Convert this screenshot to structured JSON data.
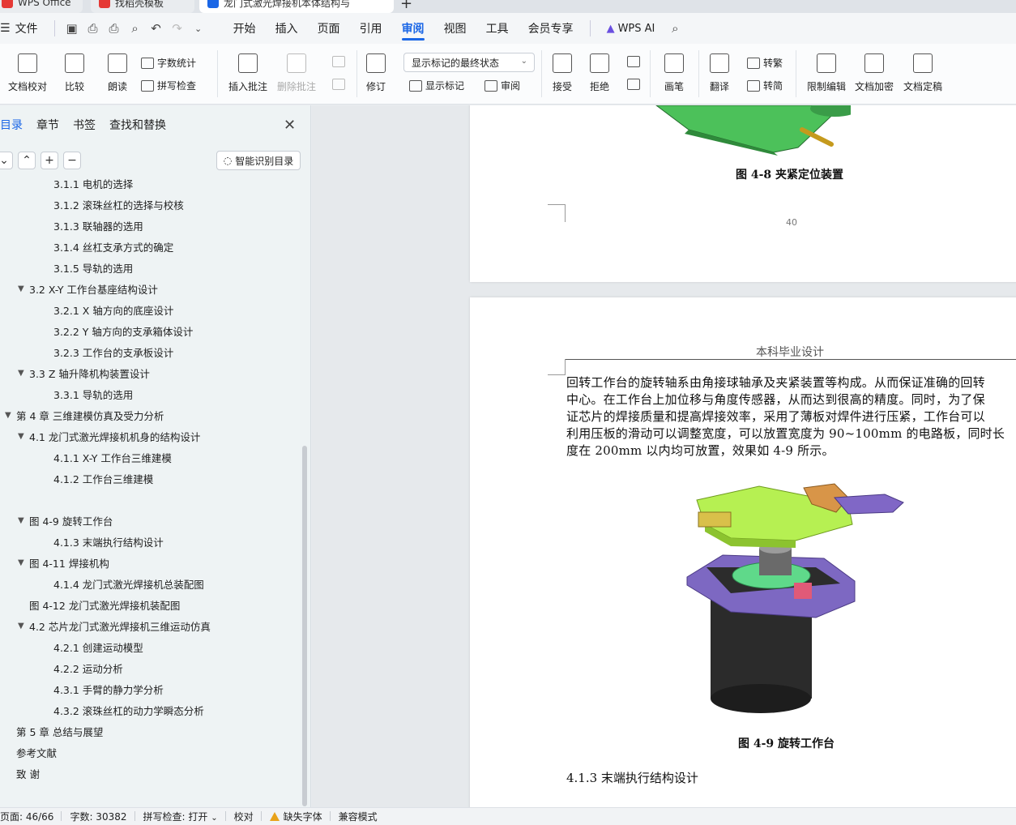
{
  "tabs": [
    {
      "label": "WPS Office",
      "color": "#e53935"
    },
    {
      "label": "找稻壳模板",
      "color": "#e53935"
    },
    {
      "label": "龙门式激光焊接机本体结构与",
      "color": "#1a66e6"
    }
  ],
  "menu": {
    "file": "文件",
    "items": [
      "开始",
      "插入",
      "页面",
      "引用",
      "审阅",
      "视图",
      "工具",
      "会员专享"
    ],
    "active": "审阅",
    "wps_ai": "WPS AI"
  },
  "ribbon": {
    "doc_proof": "文档校对",
    "compare": "比较",
    "read_aloud": "朗读",
    "word_count": "字数统计",
    "spell_check": "拼写检查",
    "insert_comment": "插入批注",
    "delete_comment": "删除批注",
    "revise": "修订",
    "markup_select": "显示标记的最终状态",
    "show_markup": "显示标记",
    "review": "审阅",
    "accept": "接受",
    "reject": "拒绝",
    "pen": "画笔",
    "translate": "翻译",
    "to_traditional": "转繁",
    "to_simplified": "转简",
    "restrict_edit": "限制编辑",
    "encrypt": "文档加密",
    "finalize": "文档定稿"
  },
  "sidebar": {
    "tabs": [
      "目录",
      "章节",
      "书签",
      "查找和替换"
    ],
    "smart_toc": "智能识别目录",
    "toc": [
      {
        "text": "3.1.1  电机的选择",
        "level": 3,
        "arrow": ""
      },
      {
        "text": "3.1.2 滚珠丝杠的选择与校核",
        "level": 3,
        "arrow": ""
      },
      {
        "text": "3.1.3  联轴器的选用",
        "level": 3,
        "arrow": ""
      },
      {
        "text": "3.1.4  丝杠支承方式的确定",
        "level": 3,
        "arrow": ""
      },
      {
        "text": "3.1.5  导轨的选用",
        "level": 3,
        "arrow": ""
      },
      {
        "text": "3.2    X-Y 工作台基座结构设计",
        "level": 2,
        "arrow": "▼"
      },
      {
        "text": "3.2.1    X 轴方向的底座设计",
        "level": 3,
        "arrow": ""
      },
      {
        "text": "3.2.2    Y 轴方向的支承箱体设计",
        "level": 3,
        "arrow": ""
      },
      {
        "text": "3.2.3    工作台的支承板设计",
        "level": 3,
        "arrow": ""
      },
      {
        "text": "3.3    Z 轴升降机构装置设计",
        "level": 2,
        "arrow": "▼"
      },
      {
        "text": "3.3.1  导轨的选用",
        "level": 3,
        "arrow": ""
      },
      {
        "text": "第 4 章  三维建模仿真及受力分析",
        "level": 1,
        "arrow": "▼"
      },
      {
        "text": "4.1  龙门式激光焊接机机身的结构设计",
        "level": 2,
        "arrow": "▼"
      },
      {
        "text": "4.1.1    X-Y 工作台三维建模",
        "level": 3,
        "arrow": ""
      },
      {
        "text": "4.1.2    工作台三维建模",
        "level": 3,
        "arrow": ""
      },
      {
        "text": "",
        "level": 3,
        "arrow": ""
      },
      {
        "text": "图 4-9      旋转工作台",
        "level": 2,
        "arrow": "▼"
      },
      {
        "text": "4.1.3    末端执行结构设计",
        "level": 3,
        "arrow": ""
      },
      {
        "text": "图 4-11       焊接机构",
        "level": 2,
        "arrow": "▼"
      },
      {
        "text": "4.1.4    龙门式激光焊接机总装配图",
        "level": 3,
        "arrow": ""
      },
      {
        "text": "图 4-12      龙门式激光焊接机装配图",
        "level": 2,
        "arrow": ""
      },
      {
        "text": "4.2  芯片龙门式激光焊接机三维运动仿真",
        "level": 2,
        "arrow": "▼"
      },
      {
        "text": "4.2.1  创建运动模型",
        "level": 3,
        "arrow": ""
      },
      {
        "text": "4.2.2  运动分析",
        "level": 3,
        "arrow": ""
      },
      {
        "text": "4.3.1  手臂的静力学分析",
        "level": 3,
        "arrow": ""
      },
      {
        "text": "4.3.2  滚珠丝杠的动力学瞬态分析",
        "level": 3,
        "arrow": ""
      },
      {
        "text": "第 5 章  总结与展望",
        "level": 1,
        "arrow": ""
      },
      {
        "text": "参考文献",
        "level": 1,
        "arrow": ""
      },
      {
        "text": "致    谢",
        "level": 1,
        "arrow": ""
      }
    ]
  },
  "document": {
    "fig48_caption": "图 4-8    夹紧定位装置",
    "page_number": "40",
    "header": "本科毕业设计",
    "paragraph_lines": [
      "回转工作台的旋转轴系由角接球轴承及夹紧装置等构成。从而保证准确的回转",
      "中心。在工作台上加位移与角度传感器，从而达到很高的精度。同时，为了保",
      "证芯片的焊接质量和提高焊接效率，采用了薄板对焊件进行压紧，工作台可以",
      "利用压板的滑动可以调整宽度，可以放置宽度为 90~100mm 的电路板，同时长",
      "度在 200mm 以内均可放置，效果如 4-9 所示。"
    ],
    "fig49_caption": "图 4-9     旋转工作台",
    "section_heading": "4.1.3    末端执行结构设计"
  },
  "status": {
    "page": "页面: 46/66",
    "words": "字数: 30382",
    "spell": "拼写检查: 打开",
    "proof": "校对",
    "missing_font": "缺失字体",
    "compat": "兼容模式"
  },
  "colors": {
    "accent": "#1a66e6",
    "green_part": "#a6e635",
    "purple_part": "#7b5fb8",
    "cylinder": "#2a2a2a"
  }
}
